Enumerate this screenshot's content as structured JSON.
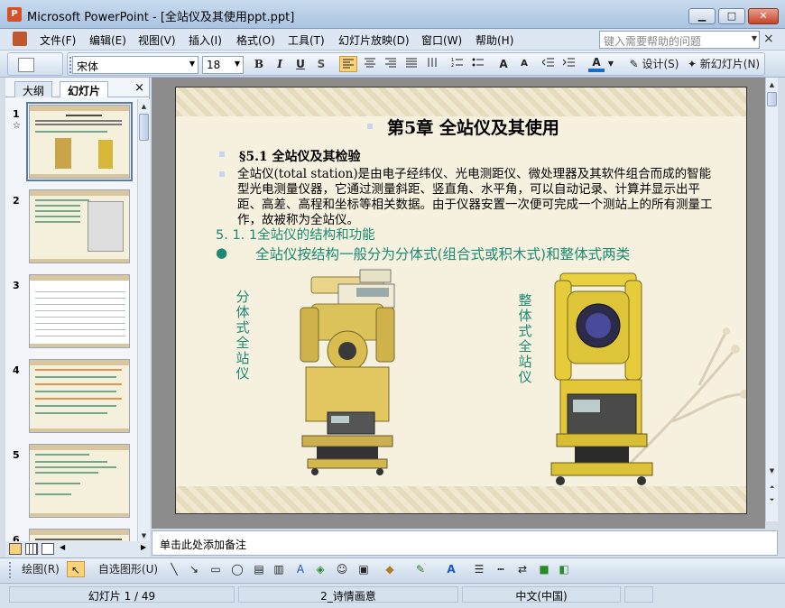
{
  "window": {
    "title": "Microsoft PowerPoint - [全站仪及其使用ppt.ppt]",
    "minimize": "▁",
    "maximize": "□",
    "close": "✕"
  },
  "menu": {
    "items": [
      "文件(F)",
      "编辑(E)",
      "视图(V)",
      "插入(I)",
      "格式(O)",
      "工具(T)",
      "幻灯片放映(D)",
      "窗口(W)",
      "帮助(H)"
    ],
    "help_placeholder": "键入需要帮助的问题",
    "close": "×"
  },
  "toolbar": {
    "font_name": "宋体",
    "font_size": "18",
    "bold": "B",
    "italic": "I",
    "underline": "U",
    "shadow": "S",
    "grow_font": "A",
    "shrink_font": "A",
    "font_color": "A",
    "design_label": "设计(S)",
    "new_slide_label": "新幻灯片(N)"
  },
  "left_pane": {
    "tab_outline": "大纲",
    "tab_slides": "幻灯片",
    "close": "×",
    "slide_numbers": [
      "1",
      "2",
      "3",
      "4",
      "5",
      "6"
    ]
  },
  "slide": {
    "title": "第5章 全站仪及其使用",
    "subheading": "§5.1 全站仪及其检验",
    "paragraph": "全站仪(total station)是由电子经纬仪、光电测距仪、微处理器及其软件组合而成的智能型光电测量仪器，它通过测量斜距、竖直角、水平角，可以自动记录、计算并显示出平距、高差、高程和坐标等相关数据。由于仪器安置一次便可完成一个测站上的所有测量工作，故被称为全站仪。",
    "section_line": "5. 1. 1全站仪的结构和功能",
    "green_bullet": "●",
    "green_text": "全站仪按结构一般分为分体式(组合式或积木式)和整体式两类",
    "label_left": "分体式全站仪",
    "label_right": "整体式全站仪"
  },
  "notes": {
    "placeholder": "单击此处添加备注"
  },
  "drawing_toolbar": {
    "draw_label": "绘图(R)",
    "autoshapes_label": "自选图形(U)"
  },
  "status": {
    "slide_info": "幻灯片 1 / 49",
    "design": "2_诗情画意",
    "language": "中文(中国)"
  }
}
